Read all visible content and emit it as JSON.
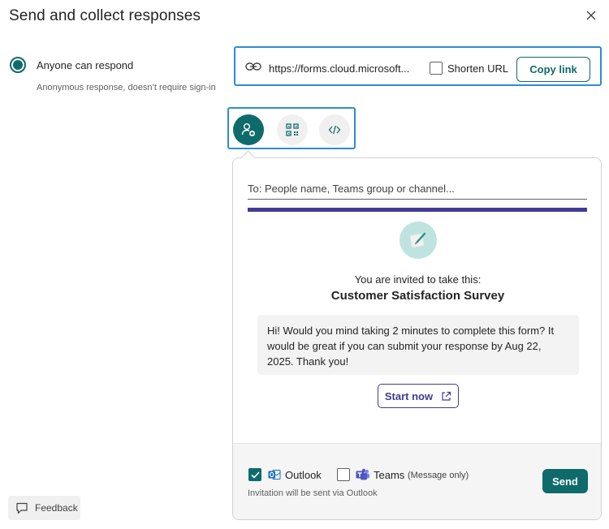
{
  "dialog": {
    "title": "Send and collect responses"
  },
  "audience": {
    "selected_label": "Anyone can respond",
    "sublabel": "Anonymous response, doesn’t require sign-in"
  },
  "link": {
    "url": "https://forms.cloud.microsoft...",
    "shorten_label": "Shorten URL",
    "shorten_checked": false,
    "copy_label": "Copy link"
  },
  "share_options": {
    "icons": [
      "invite-people-icon",
      "qr-code-icon",
      "embed-code-icon"
    ],
    "selected": "invite-people-icon"
  },
  "invite": {
    "to_placeholder": "To: People name, Teams group or channel...",
    "invited_text": "You are invited to take this:",
    "survey_title": "Customer Satisfaction Survey",
    "message": "Hi! Would you mind taking 2 minutes to complete this form? It would be great if you can submit your response by Aug 22, 2025. Thank you!",
    "start_label": "Start now",
    "channels": {
      "outlook_label": "Outlook",
      "outlook_checked": true,
      "teams_label": "Teams",
      "teams_note": "(Message only)",
      "teams_checked": false
    },
    "via_text": "Invitation will be sent via Outlook",
    "send_label": "Send"
  },
  "feedback_label": "Feedback",
  "colors": {
    "accent": "#0f6b6b",
    "focus_outline": "#2d8cd3",
    "banner": "#403c94",
    "survey_icon_bg": "#bfe4e0"
  }
}
